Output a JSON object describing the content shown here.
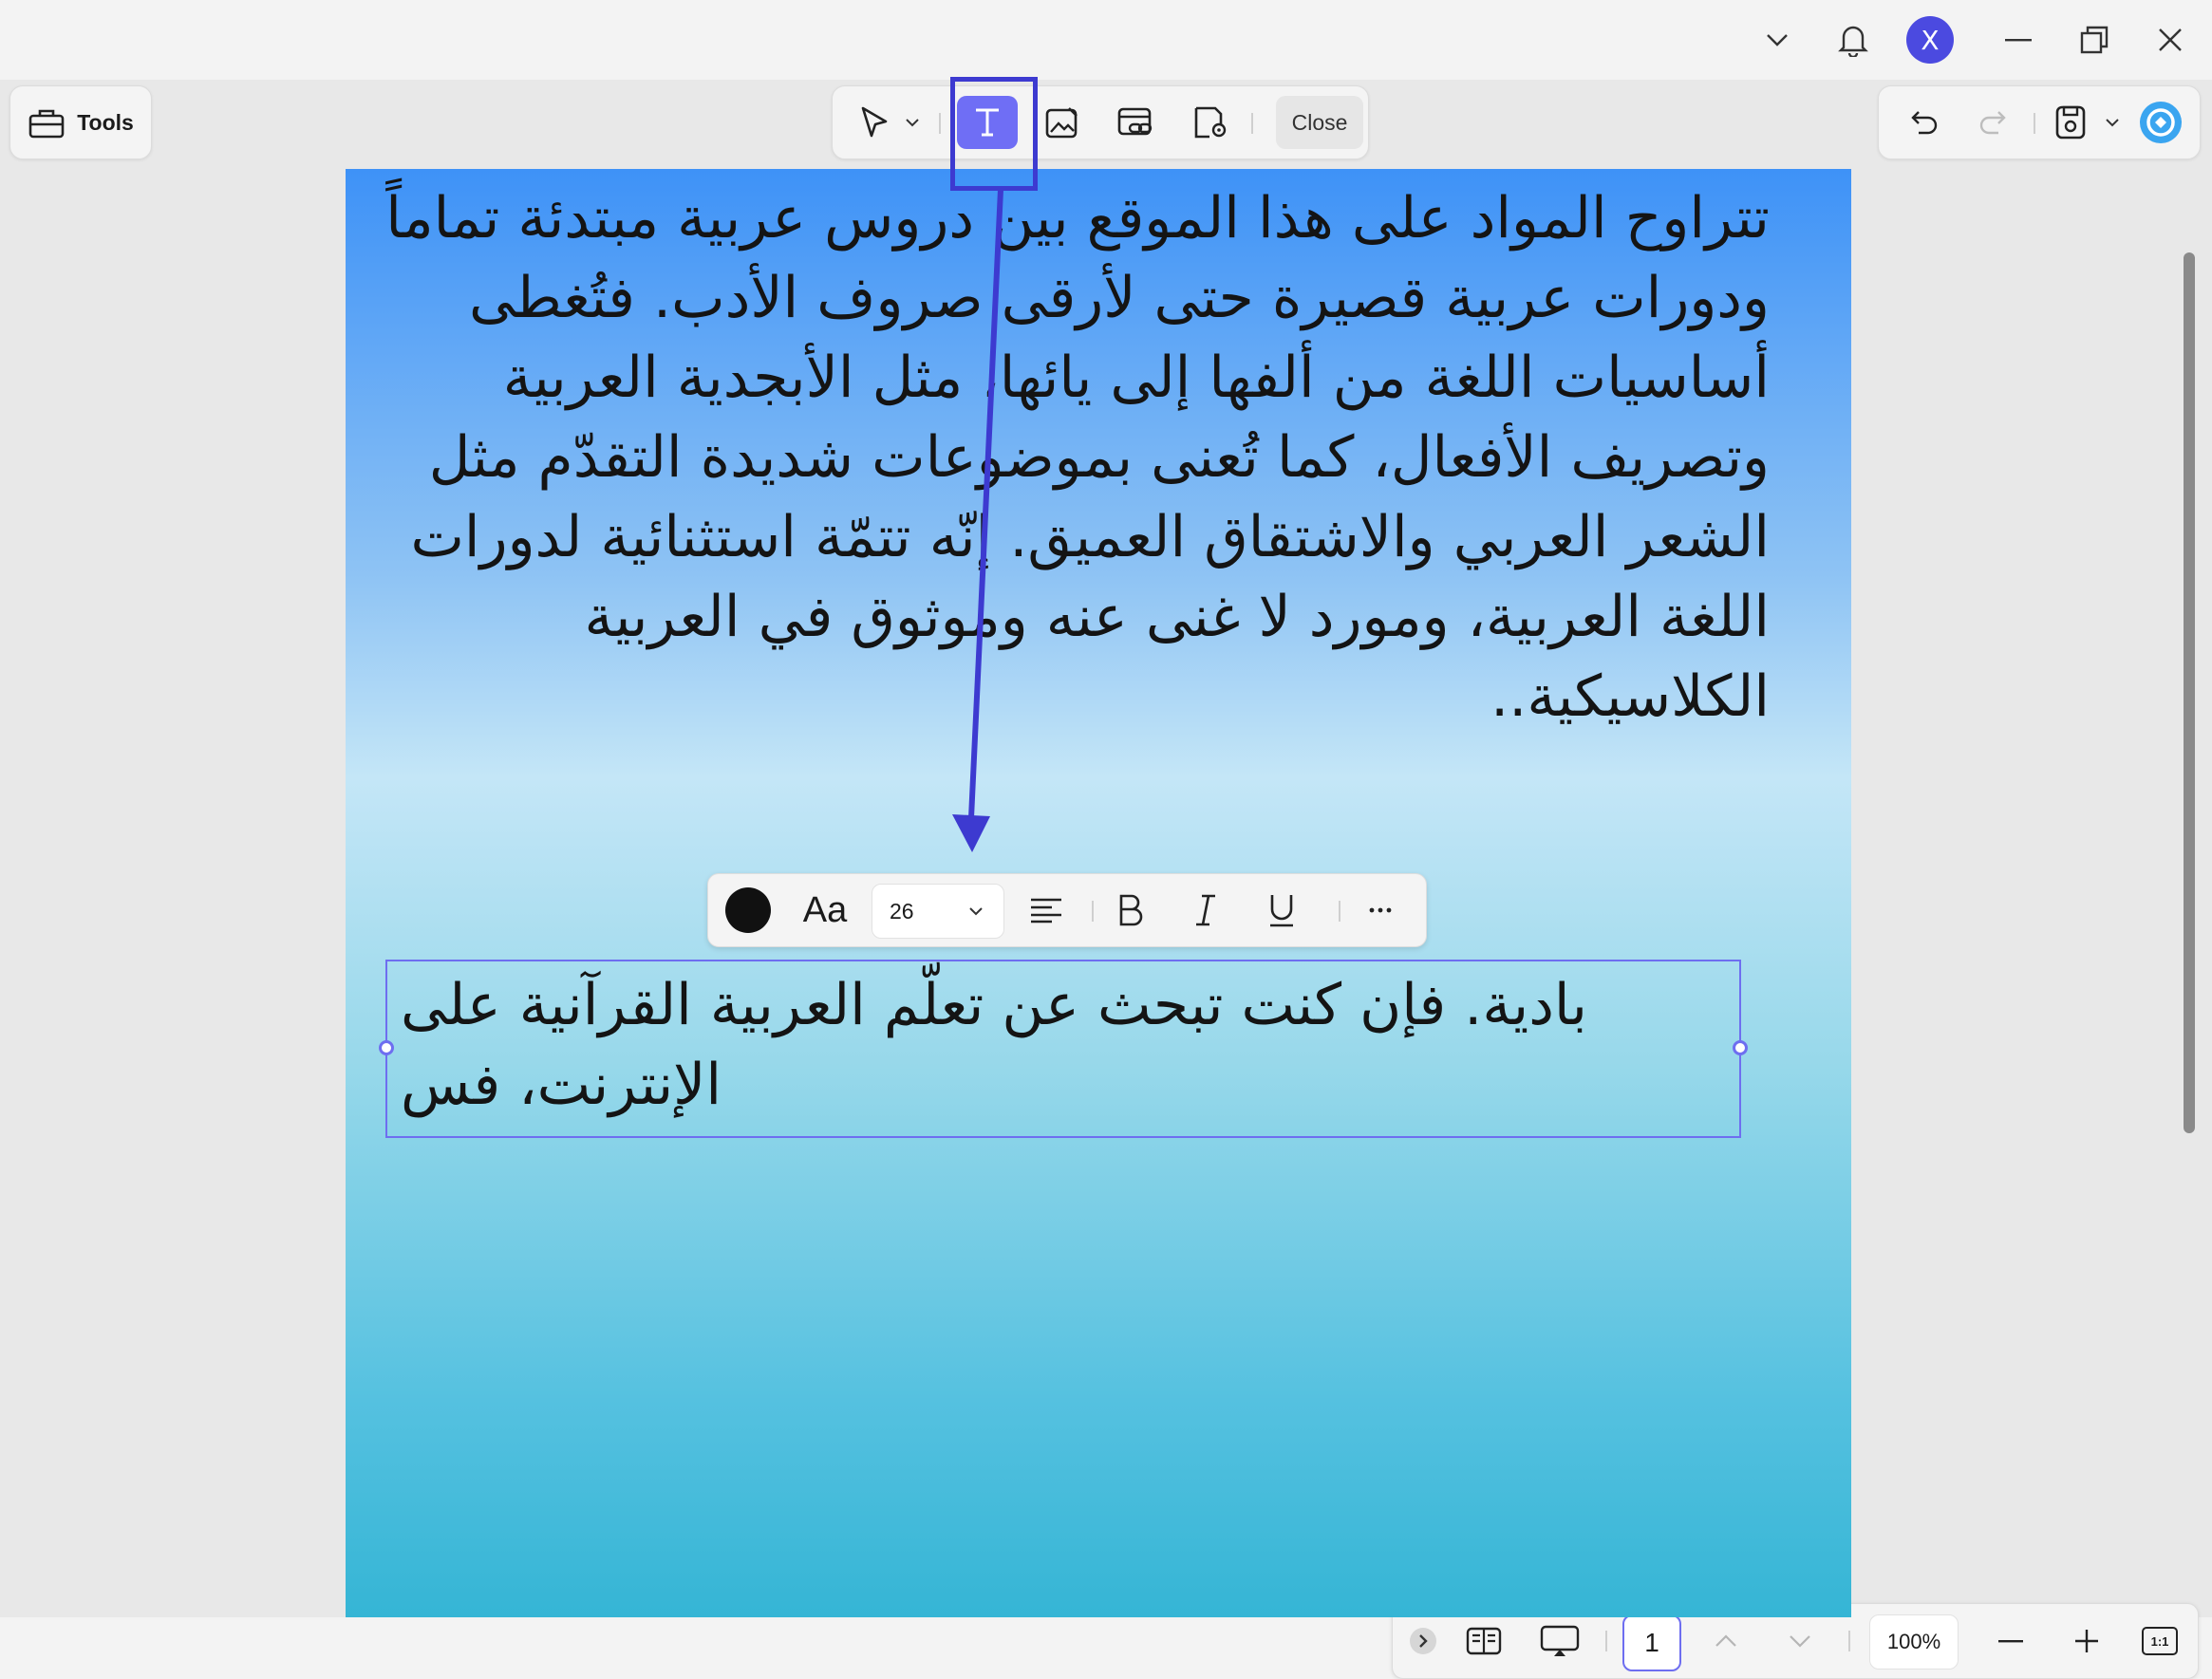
{
  "titlebar": {
    "avatar_letter": "X",
    "icons": [
      "chevron-down-icon",
      "bell-icon",
      "minimize-icon",
      "restore-icon",
      "close-icon"
    ]
  },
  "toolbar": {
    "tools_label": "Tools",
    "close_label": "Close",
    "active_tool": "text-tool",
    "accent_color": "#6f6ef5"
  },
  "document": {
    "paragraph": "تتراوح المواد على هذا الموقع بين دروس عربية مبتدئة تماماً ودورات عربية قصيرة حتى لأرقى صروف الأدب. فتُغطى أساسيات اللغة من ألفها إلى يائها، مثل الأبجدية العربية وتصريف الأفعال، كما تُعنى بموضوعات شديدة التقدّم مثل الشعر العربي والاشتقاق العميق. إنّه تتمّة استثنائية لدورات اللغة العربية، ومورد لا غنى عنه وموثوق في العربية الكلاسيكية..",
    "editing_text": "بادية. فإن كنت تبحث عن تعلّم العربية القرآنية على الإنترنت، فس"
  },
  "format_toolbar": {
    "font_label": "Aa",
    "font_size": "26",
    "text_color": "#111111"
  },
  "bottom_bar": {
    "page_number": "1",
    "zoom": "100%",
    "fit_label": "1:1"
  }
}
